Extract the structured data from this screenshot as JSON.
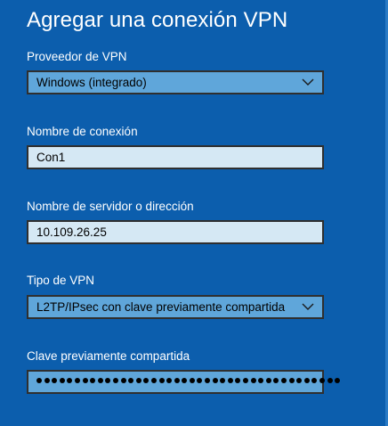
{
  "title": "Agregar una conexión VPN",
  "vpn_provider": {
    "label": "Proveedor de VPN",
    "selected": "Windows (integrado)"
  },
  "connection_name": {
    "label": "Nombre de conexión",
    "value": "Con1"
  },
  "server": {
    "label": "Nombre de servidor o dirección",
    "value": "10.109.26.25"
  },
  "vpn_type": {
    "label": "Tipo de VPN",
    "selected": "L2TP/IPsec con clave previamente compartida"
  },
  "preshared_key": {
    "label": "Clave previamente compartida",
    "masked_length": 40
  },
  "colors": {
    "background": "#0c5ead",
    "select_fill": "#5fa6da",
    "input_fill": "#d5e8f4",
    "border": "#2f2f2f"
  },
  "icons": {
    "dropdown": "chevron-down-icon"
  }
}
